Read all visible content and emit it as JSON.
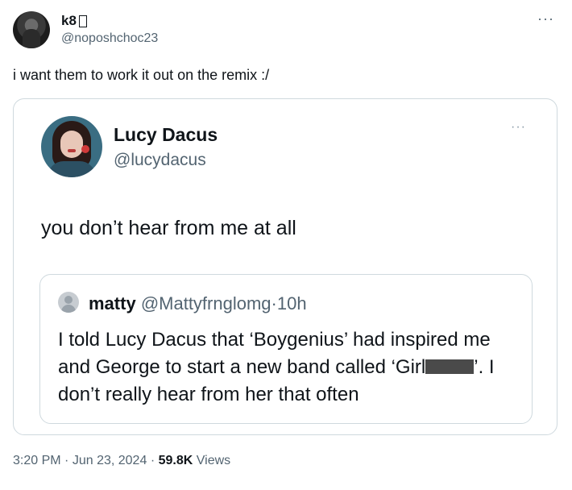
{
  "author": {
    "name": "k8",
    "handle": "@noposhchoc23",
    "more_icon": "more-horizontal-icon"
  },
  "tweet_text": "i want them to work it out on the remix :/",
  "quoted": {
    "name": "Lucy Dacus",
    "handle": "@lucydacus",
    "text": "you don’t hear from me at all",
    "more_icon": "more-horizontal-icon",
    "inner_quote": {
      "name": "matty",
      "handle": "@Mattyfrnglomg",
      "separator": "·",
      "time": "10h",
      "text_before": "I told Lucy Dacus that ‘Boygenius’ had inspired me and George to start a new band called ‘Girl",
      "text_after": "’. I don’t really hear from her that often"
    }
  },
  "meta": {
    "time": "3:20 PM",
    "sep1": "·",
    "date": "Jun 23, 2024",
    "sep2": "·",
    "views_count": "59.8K",
    "views_label": "Views"
  }
}
